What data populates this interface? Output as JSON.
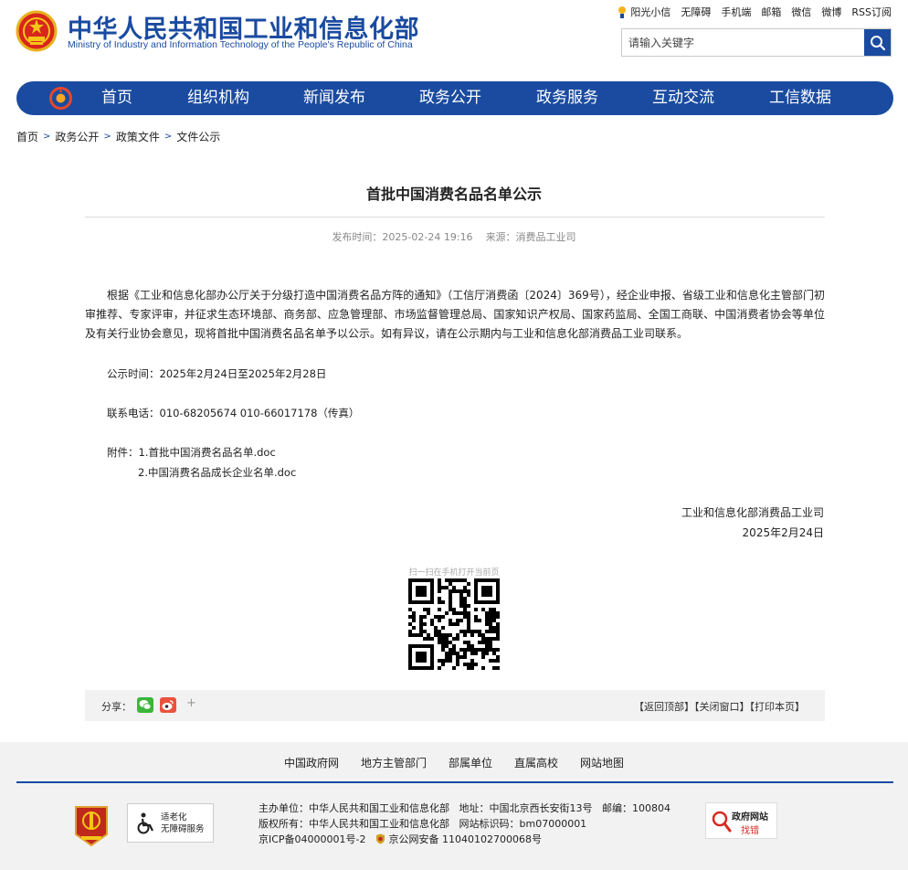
{
  "header": {
    "title_cn": "中华人民共和国工业和信息化部",
    "title_en": "Ministry of Industry and Information Technology of the People's Republic of China",
    "top_links": [
      "阳光小信",
      "无障碍",
      "手机端",
      "邮箱",
      "微信",
      "微博",
      "RSS订阅"
    ],
    "search_placeholder": "请输入关键字"
  },
  "nav": {
    "items": [
      "首页",
      "组织机构",
      "新闻发布",
      "政务公开",
      "政务服务",
      "互动交流",
      "工信数据"
    ]
  },
  "breadcrumb": [
    "首页",
    "政务公开",
    "政策文件",
    "文件公示"
  ],
  "article": {
    "title": "首批中国消费名品名单公示",
    "publish_time": "发布时间：2025-02-24 19:16",
    "source": "来源：消费品工业司",
    "body": "根据《工业和信息化部办公厅关于分级打造中国消费名品方阵的通知》（工信厅消费函〔2024〕369号），经企业申报、省级工业和信息化主管部门初审推荐、专家评审，并征求生态环境部、商务部、应急管理部、市场监督管理总局、国家知识产权局、国家药监局、全国工商联、中国消费者协会等单位及有关行业协会意见，现将首批中国消费名品名单予以公示。如有异议，请在公示期内与工业和信息化部消费品工业司联系。",
    "period": "公示时间：2025年2月24日至2025年2月28日",
    "phone": "联系电话：010-68205674  010-66017178（传真）",
    "attachment_1": "附件：1.首批中国消费名品名单.doc",
    "attachment_2": "2.中国消费名品成长企业名单.doc",
    "signature": "工业和信息化部消费品工业司",
    "date": "2025年2月24日"
  },
  "qr": {
    "label": "扫一扫在手机打开当前页"
  },
  "share": {
    "label": "分享：",
    "plus": "+",
    "back_top": "【返回顶部】",
    "close_window": "【关闭窗口】",
    "print": "【打印本页】"
  },
  "footer": {
    "links": [
      "中国政府网",
      "地方主管部门",
      "部属单位",
      "直属高校",
      "网站地图"
    ],
    "badge2_line1": "适老化",
    "badge2_line2": "无障碍服务",
    "sponsor": "主办单位：中华人民共和国工业和信息化部",
    "address": "地址：中国北京西长安街13号",
    "postcode": "邮编：100804",
    "copyright": "版权所有：中华人民共和国工业和信息化部",
    "site_code": "网站标识码：bm07000001",
    "icp": "京ICP备04000001号-2",
    "police": "京公网安备 11040102700068号",
    "badge3_top": "政府网站",
    "badge3_bottom": "找错"
  },
  "colors": {
    "brand_blue": "#1a4ba0",
    "meta_gray": "#888888",
    "footer_bg": "#f2f2f2"
  }
}
